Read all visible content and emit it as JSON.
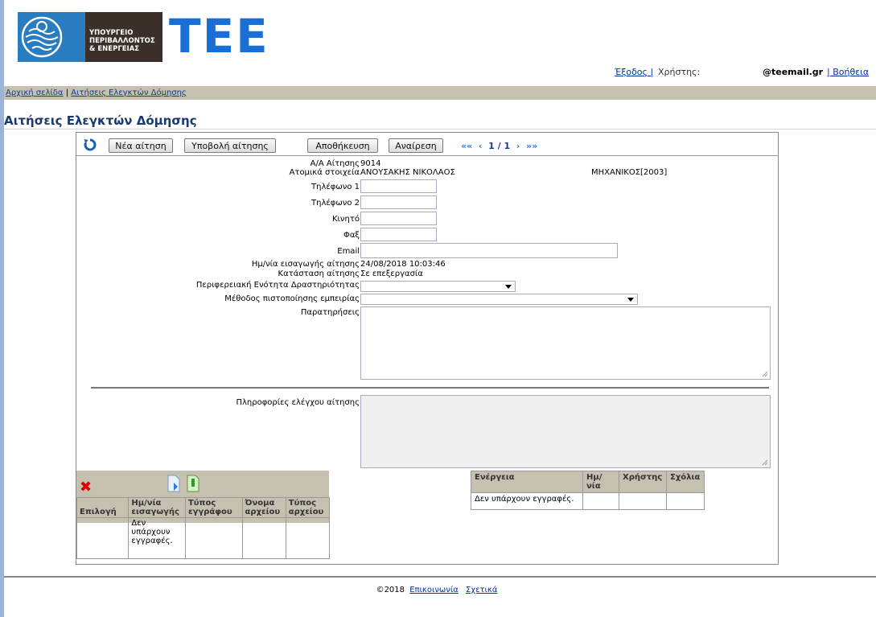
{
  "header": {
    "ministry_lines": [
      "ΥΠΟΥΡΓΕΙΟ",
      "ΠΕΡΙΒΑΛΛΟΝΤΟΣ",
      "& ΕΝΕΡΓΕΙΑΣ"
    ],
    "brand": "TEE",
    "logout": "Έξοδος |",
    "user_label": "Χρήστης:",
    "user_email": "@teemail.gr",
    "help": "| Βοήθεια"
  },
  "breadcrumb": {
    "home": "Αρχική σελίδα",
    "sep": "|",
    "current": "Αιτήσεις Ελεγκτών Δόμησης"
  },
  "page_title": "Αιτήσεις Ελεγκτών Δόμησης",
  "toolbar": {
    "new": "Νέα αίτηση",
    "submit": "Υποβολή αίτησης",
    "save": "Αποθήκευση",
    "cancel": "Αναίρεση",
    "first": "«",
    "prev": "‹",
    "page": "1 / 1",
    "next": "›",
    "last": "»"
  },
  "form": {
    "aa_label": "Α/Α Αίτησης",
    "aa_value": "9014",
    "personal_label": "Ατομικά στοιχεία",
    "personal_name": "ΑΝΟΥΣΑΚΗΣ ΝΙΚΟΛΑΟΣ",
    "personal_specialty": "ΜΗΧΑΝΙΚΟΣ[2003]",
    "phone1_label": "Τηλέφωνο 1",
    "phone2_label": "Τηλέφωνο 2",
    "mobile_label": "Κινητό",
    "fax_label": "Φαξ",
    "email_label": "Email",
    "date_label": "Ημ/νία εισαγωγής αίτησης",
    "date_value": "24/08/2018 10:03:46",
    "status_label": "Κατάσταση αίτησης",
    "status_value": "Σε επεξεργασία",
    "region_label": "Περιφερειακή Ενότητα Δραστηριότητας",
    "method_label": "Μέθοδος πιστοποίησης εμπειρίας",
    "notes_label": "Παρατηρήσεις",
    "check_label": "Πληροφορίες ελέγχου αίτησης"
  },
  "documents": {
    "headers": [
      "Επιλογή",
      "Ημ/νία εισαγωγής",
      "Τύπος εγγράφου",
      "Όνομα αρχείου",
      "Τύπος αρχείου"
    ],
    "empty": "Δεν υπάρχουν εγγραφές."
  },
  "history": {
    "headers": [
      "Ενέργεια",
      "Ημ/νία",
      "Χρήστης",
      "Σχόλια"
    ],
    "empty": "Δεν υπάρχουν εγγραφές."
  },
  "footer": {
    "copyright": "©2018",
    "contact": "Επικοινωνία",
    "about": "Σχετικά"
  }
}
